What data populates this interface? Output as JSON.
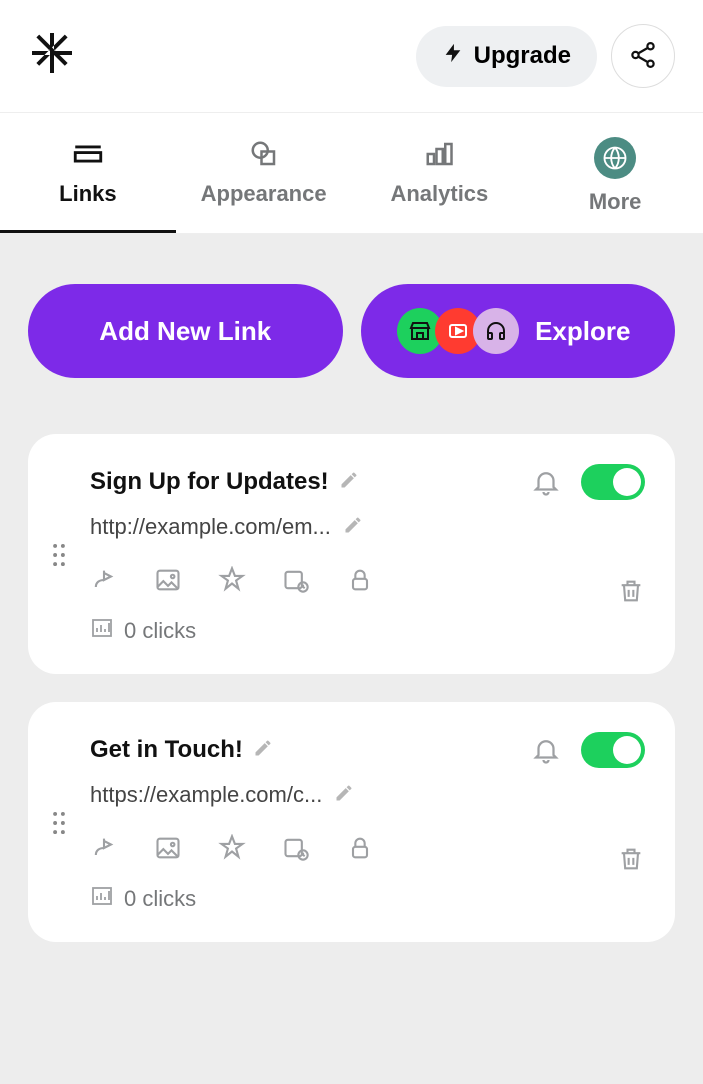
{
  "header": {
    "upgrade_label": "Upgrade"
  },
  "tabs": [
    {
      "label": "Links",
      "active": true
    },
    {
      "label": "Appearance",
      "active": false
    },
    {
      "label": "Analytics",
      "active": false
    },
    {
      "label": "More",
      "active": false
    }
  ],
  "actions": {
    "add_label": "Add New Link",
    "explore_label": "Explore"
  },
  "links": [
    {
      "title": "Sign Up for Updates!",
      "url": "http://example.com/em...",
      "enabled": true,
      "clicks_label": "0 clicks"
    },
    {
      "title": "Get in Touch!",
      "url": "https://example.com/c...",
      "enabled": true,
      "clicks_label": "0 clicks"
    }
  ]
}
